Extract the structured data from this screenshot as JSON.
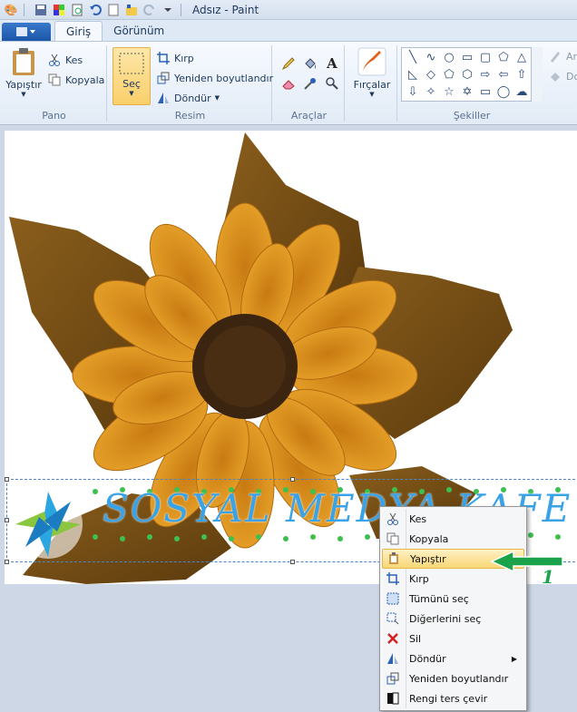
{
  "window": {
    "title": "Adsız - Paint"
  },
  "tabs": [
    {
      "label": "Giriş"
    },
    {
      "label": "Görünüm"
    }
  ],
  "ribbon": {
    "pano": {
      "label": "Pano",
      "paste": "Yapıştır",
      "cut": "Kes",
      "copy": "Kopyala"
    },
    "resim": {
      "label": "Resim",
      "select": "Seç",
      "crop": "Kırp",
      "resize": "Yeniden boyutlandır",
      "rotate": "Döndür"
    },
    "araclar": {
      "label": "Araçlar"
    },
    "brushes": {
      "label": "Fırçalar"
    },
    "sekiller": {
      "label": "Şekiller",
      "outline": "Ar",
      "fill": "Do"
    }
  },
  "canvas": {
    "watermark": "SOSYAL MEDYA KAFE"
  },
  "context_menu": {
    "items": [
      {
        "label": "Kes",
        "icon": "scissors-icon"
      },
      {
        "label": "Kopyala",
        "icon": "copy-icon"
      },
      {
        "label": "Yapıştır",
        "icon": "clipboard-icon",
        "highlighted": true
      },
      {
        "label": "Kırp",
        "icon": "crop-icon"
      },
      {
        "label": "Tümünü seç",
        "icon": "select-all-icon"
      },
      {
        "label": "Diğerlerini seç",
        "icon": "invert-selection-icon"
      },
      {
        "label": "Sil",
        "icon": "delete-icon"
      },
      {
        "label": "Döndür",
        "icon": "rotate-icon",
        "submenu": true
      },
      {
        "label": "Yeniden boyutlandır",
        "icon": "resize-icon"
      },
      {
        "label": "Rengi ters çevir",
        "icon": "invert-color-icon"
      }
    ]
  },
  "annotation": {
    "number": "1",
    "color": "#1aa34a"
  },
  "colors": {
    "accent": "#3a78c9",
    "highlight": "#f9d776"
  }
}
